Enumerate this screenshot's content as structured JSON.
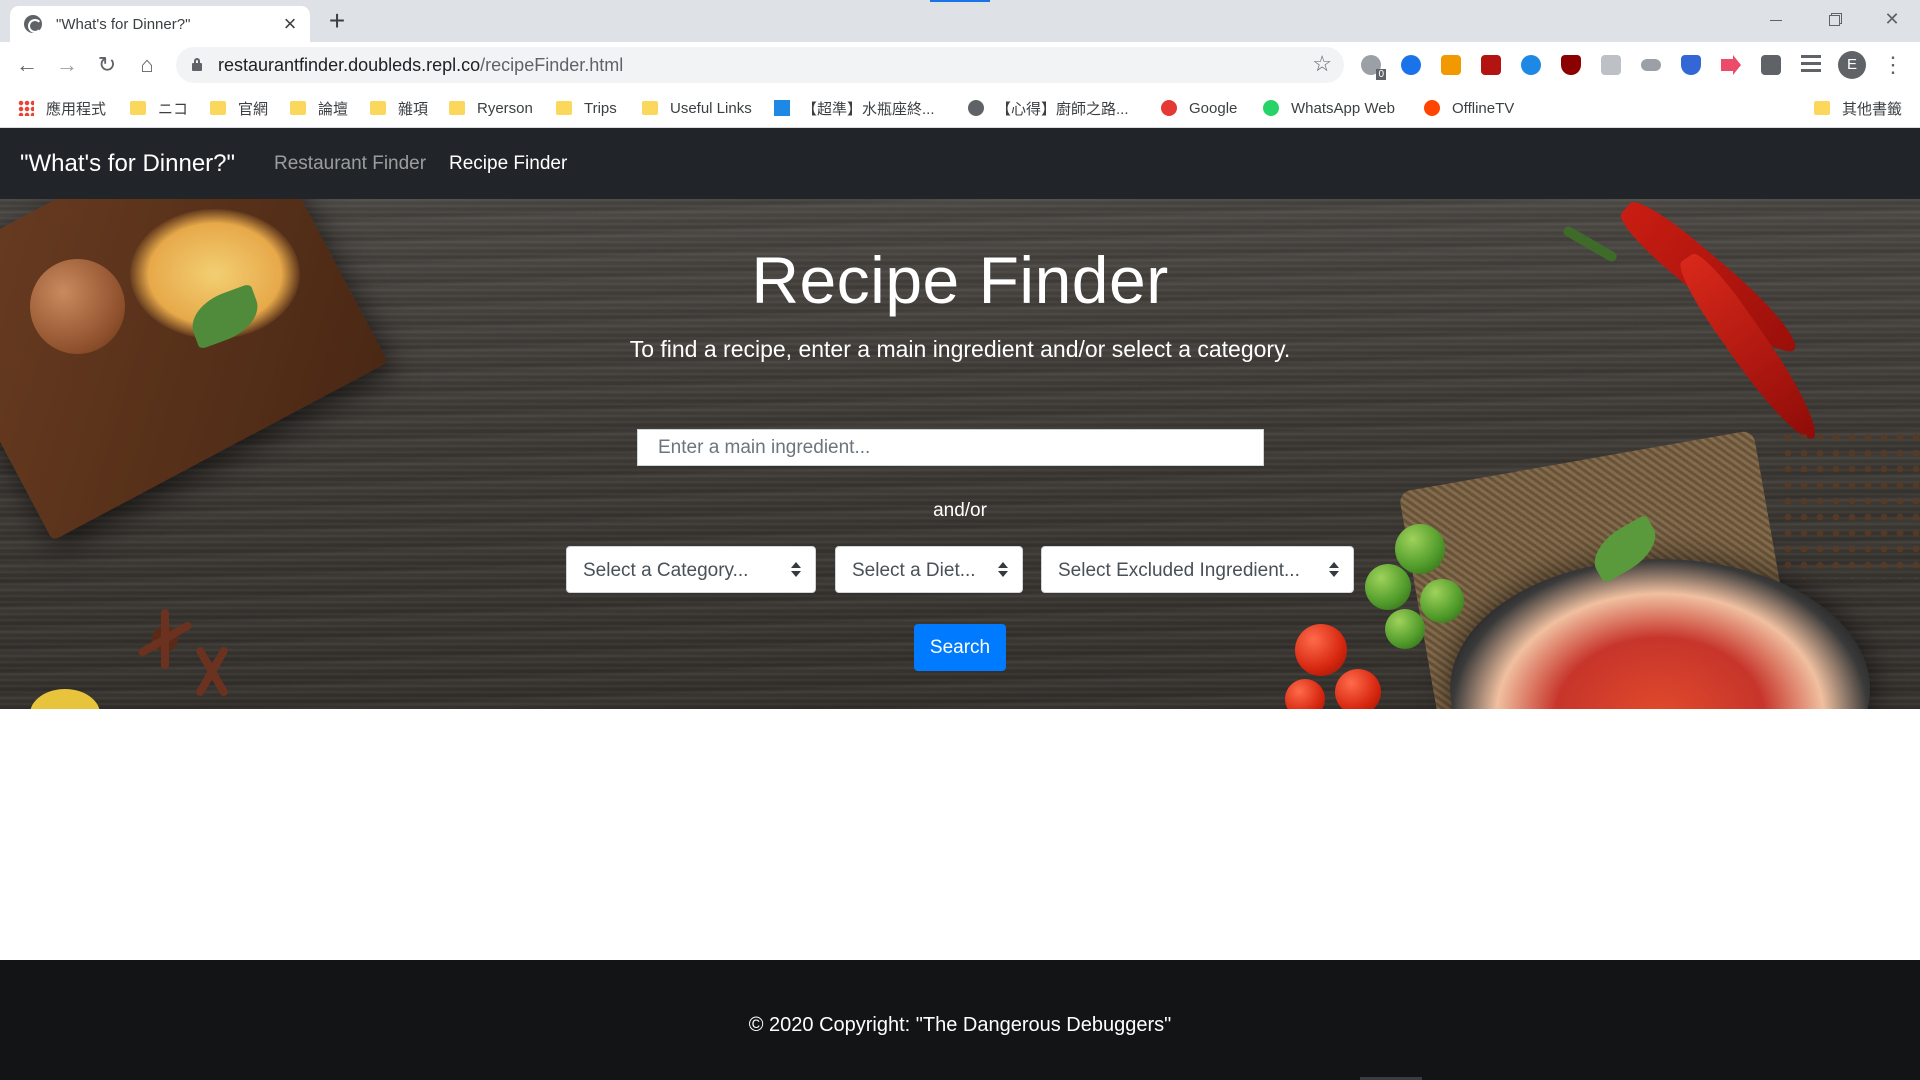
{
  "browser": {
    "tab_title": "\"What's for Dinner?\"",
    "tab_close": "×",
    "new_tab": "+",
    "url_host": "restaurantfinder.doubleds.repl.co",
    "url_path": "/recipeFinder.html",
    "profile_initial": "E",
    "extension_badge": "0",
    "bookmarks": [
      {
        "label": "應用程式",
        "icon": "apps-icon"
      },
      {
        "label": "ニコ",
        "icon": "folder-icon"
      },
      {
        "label": "官網",
        "icon": "folder-icon"
      },
      {
        "label": "論壇",
        "icon": "folder-icon"
      },
      {
        "label": "雜項",
        "icon": "folder-icon"
      },
      {
        "label": "Ryerson",
        "icon": "folder-icon"
      },
      {
        "label": "Trips",
        "icon": "folder-icon"
      },
      {
        "label": "Useful Links",
        "icon": "folder-icon"
      },
      {
        "label": "【超準】水瓶座終...",
        "icon": "l-site-icon"
      },
      {
        "label": "【心得】廚師之路...",
        "icon": "globe-icon"
      },
      {
        "label": "Google",
        "icon": "google-icon"
      },
      {
        "label": "WhatsApp Web",
        "icon": "whatsapp-icon"
      },
      {
        "label": "OfflineTV",
        "icon": "reddit-icon"
      },
      {
        "label": "其他書籤",
        "icon": "folder-icon"
      }
    ]
  },
  "navbar": {
    "brand": "\"What's for Dinner?\"",
    "links": [
      "Restaurant Finder",
      "Recipe Finder"
    ],
    "active": "Recipe Finder"
  },
  "hero": {
    "title": "Recipe Finder",
    "subtitle": "To find a recipe, enter a main ingredient and/or select a category.",
    "ingredient_placeholder": "Enter a main ingredient...",
    "separator": "and/or",
    "category_select": "Select a Category...",
    "diet_select": "Select a Diet...",
    "excluded_select": "Select Excluded Ingredient...",
    "search_button": "Search"
  },
  "footer": {
    "copyright": "© 2020 Copyright: \"The Dangerous Debuggers\""
  },
  "colors": {
    "navbar_bg": "#212529",
    "primary_button": "#007bff",
    "footer_bg": "#121416"
  }
}
